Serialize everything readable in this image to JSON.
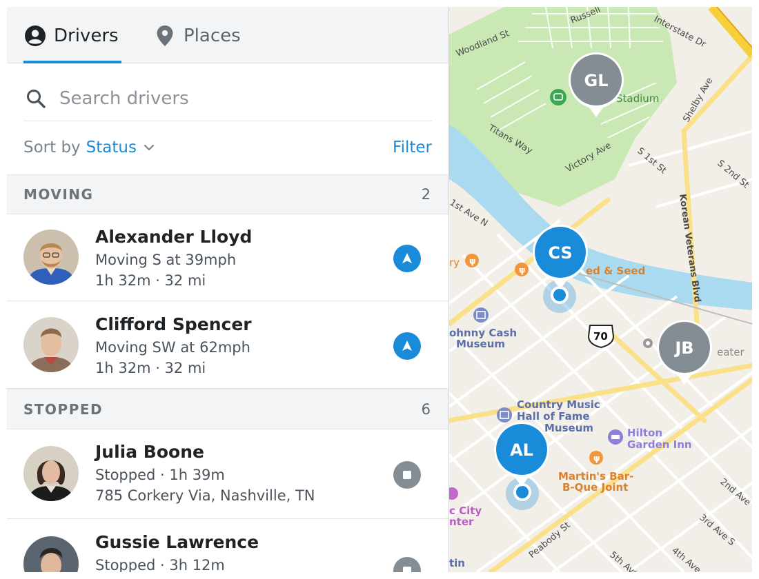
{
  "tabs": {
    "drivers_label": "Drivers",
    "places_label": "Places"
  },
  "search": {
    "placeholder": "Search drivers",
    "value": ""
  },
  "sort": {
    "prefix": "Sort by",
    "value": "Status",
    "filter_label": "Filter"
  },
  "sections": [
    {
      "label": "MOVING",
      "count": "2"
    },
    {
      "label": "STOPPED",
      "count": "6"
    }
  ],
  "drivers": [
    {
      "name": "Alexander Lloyd",
      "line1": "Moving S at 39mph",
      "line2": "1h 32m · 32 mi",
      "status": "moving",
      "status_icon": "navigation-arrow-icon"
    },
    {
      "name": "Clifford Spencer",
      "line1": "Moving SW at 62mph",
      "line2": "1h 32m · 32 mi",
      "status": "moving",
      "status_icon": "navigation-arrow-icon"
    },
    {
      "name": "Julia Boone",
      "line1": "Stopped · 1h 39m",
      "line2": "785 Corkery Via, Nashville, TN",
      "status": "stopped",
      "status_icon": "stop-square-icon"
    },
    {
      "name": "Gussie Lawrence",
      "line1": "Stopped · 3h 12m",
      "line2": "",
      "status": "stopped",
      "status_icon": "stop-square-icon"
    }
  ],
  "map": {
    "markers": [
      {
        "initials": "GL",
        "status": "stopped"
      },
      {
        "initials": "CS",
        "status": "moving"
      },
      {
        "initials": "JB",
        "status": "stopped"
      },
      {
        "initials": "AL",
        "status": "moving"
      }
    ],
    "labels": {
      "stadium": "Stadium",
      "russell": "Russell",
      "interstate": "Interstate Dr",
      "woodland": "Woodland St",
      "shelby": "Shelby Ave",
      "titans": "Titans Way",
      "victory": "Victory Ave",
      "s1st": "S 1st St",
      "s2nd": "S 2nd St",
      "korean": "Korean Veterans Blvd",
      "first_ave": "1st Ave N",
      "seed": "ed & Seed",
      "johnny1": "ohnny Cash",
      "johnny2": "Museum",
      "hwy": "70",
      "theater": "eater",
      "cmhof1": "Country Music",
      "cmhof2": "Hall of Fame",
      "cmhof3": "Museum",
      "hilton1": "Hilton",
      "hilton2": "Garden Inn",
      "martins1": "Martin's Bar-",
      "martins2": "B-Que Joint",
      "peabody": "Peabody St",
      "second_ave": "2nd Ave",
      "third_ave": "3rd Ave S",
      "fourth_ave": "4th Ave",
      "fifth_ave": "5th Ave",
      "city1": "c City",
      "city2": "nter",
      "ry": "ry",
      "tin": "tin"
    },
    "colors": {
      "land": "#f2efe9",
      "park": "#c9e8b4",
      "water": "#aadaf0",
      "major_road": "#fbe08a",
      "highway": "#f6cf3b",
      "minor_road": "#ffffff",
      "moving": "#1a8bd9",
      "stopped": "#858d94",
      "poi_orange": "#f0963c",
      "poi_purple": "#7f7fd6",
      "poi_blue": "#7b8ec8",
      "park_text": "#3f8a49",
      "museum_text": "#5a6ea8"
    }
  }
}
